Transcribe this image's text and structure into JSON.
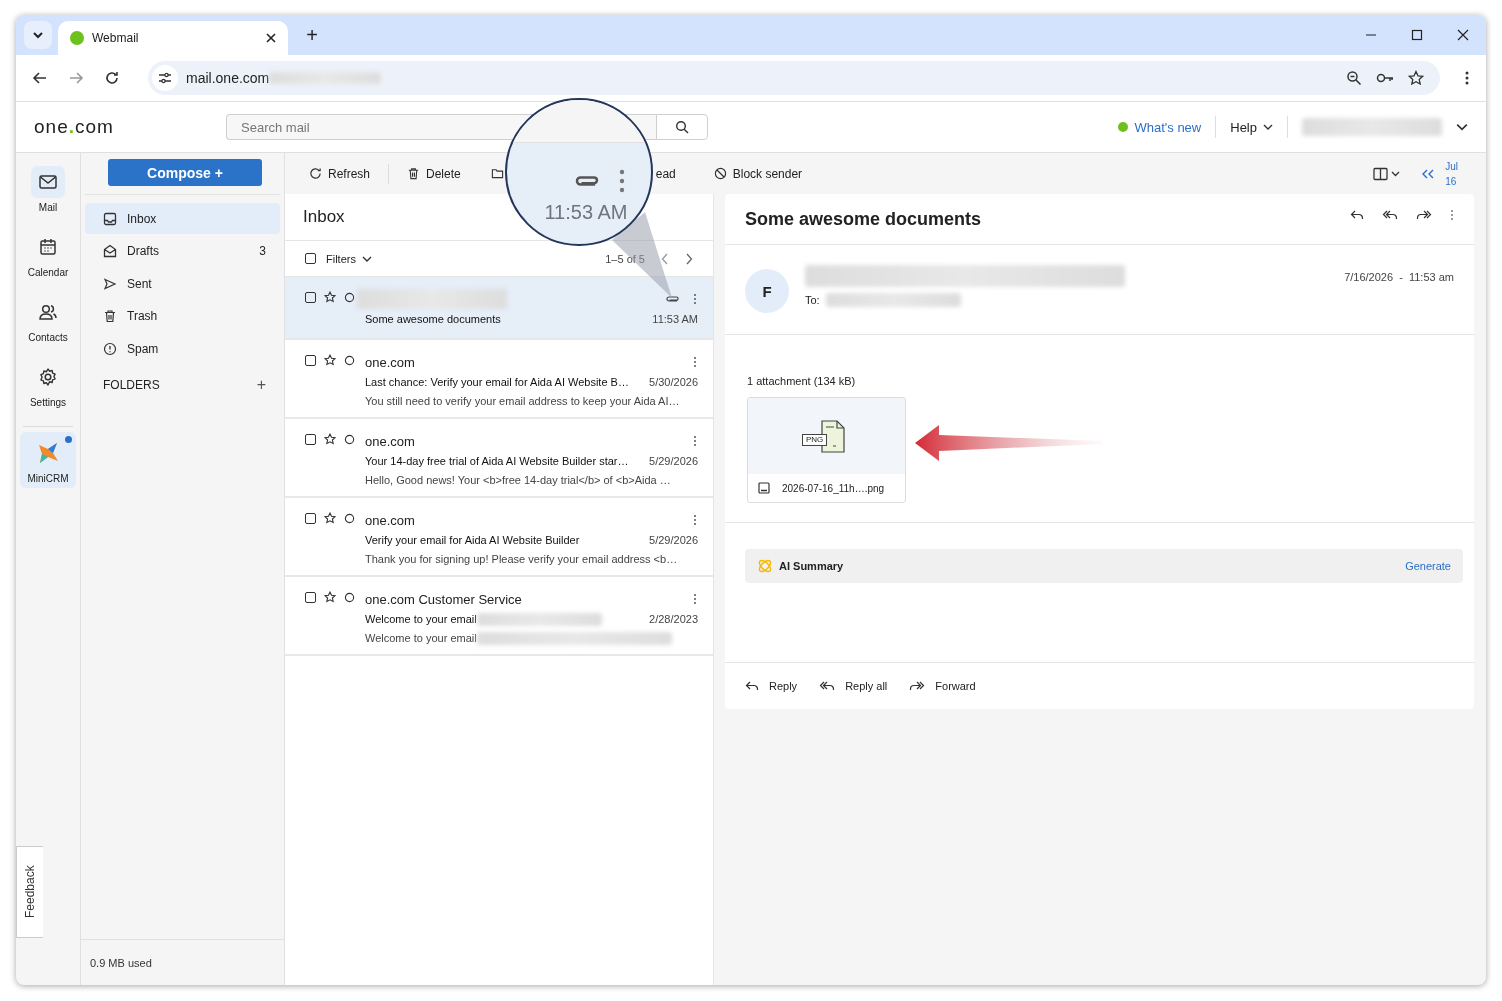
{
  "browser": {
    "tabs": [
      {
        "title": "Webmail",
        "selected": true
      }
    ],
    "new_tab": "+",
    "url": "mail.one.com"
  },
  "header": {
    "logo": [
      "one",
      ".",
      "com"
    ],
    "search": {
      "placeholder": "Search mail"
    },
    "whats_new": "What's new",
    "help": "Help"
  },
  "rail": [
    {
      "label": "Mail",
      "kind": "mail",
      "selected": true
    },
    {
      "label": "Calendar",
      "kind": "calendar",
      "selected": false
    },
    {
      "label": "Contacts",
      "kind": "contacts",
      "selected": false
    },
    {
      "label": "Settings",
      "kind": "settings",
      "selected": false
    },
    {
      "label": "MiniCRM",
      "kind": "crm",
      "selected": true,
      "notification": true
    }
  ],
  "feedback": "Feedback",
  "sidebar": {
    "compose": "Compose +",
    "folders": [
      {
        "name": "Inbox",
        "kind": "inbox",
        "selected": true
      },
      {
        "name": "Drafts",
        "kind": "drafts",
        "count": "3",
        "selected": false
      },
      {
        "name": "Sent",
        "kind": "sent",
        "selected": false
      },
      {
        "name": "Trash",
        "kind": "trash",
        "selected": false
      },
      {
        "name": "Spam",
        "kind": "spam",
        "selected": false
      }
    ],
    "folders_heading": "FOLDERS",
    "add": "+",
    "storage": "0.9 MB used"
  },
  "toolbar": [
    {
      "kind": "refresh",
      "label": "Refresh"
    },
    {
      "kind": "delete",
      "label": "Delete"
    },
    {
      "kind": "move"
    },
    {
      "kind": "text",
      "label": "ead"
    },
    {
      "kind": "block",
      "label": "Block sender"
    }
  ],
  "date_nav": {
    "month": "Jul",
    "day": "16"
  },
  "list": {
    "title": "Inbox",
    "select_all_checked": false,
    "filters": "Filters",
    "range": "1–5 of 5",
    "messages": [
      {
        "subject": "Some awesome documents",
        "date": "11:53 AM",
        "attachment": true,
        "selected": true,
        "checked": false,
        "starred": false
      },
      {
        "sender": "one.com",
        "subject": "Last chance: Verify your email for Aida AI Website B…",
        "preview": "You still need to verify your email address to keep your Aida AI…",
        "date": "5/30/2026",
        "attachment": false,
        "selected": false,
        "checked": false,
        "starred": false
      },
      {
        "sender": "one.com",
        "subject": "Your 14-day free trial of Aida AI Website Builder star…",
        "preview": "Hello, Good news! Your <b>free 14-day trial</b> of <b>Aida …",
        "date": "5/29/2026",
        "attachment": false,
        "selected": false,
        "checked": false,
        "starred": false
      },
      {
        "sender": "one.com",
        "subject": "Verify your email for Aida AI Website Builder",
        "preview": "Thank you for signing up! Please verify your email address <b…",
        "date": "5/29/2026",
        "attachment": false,
        "selected": false,
        "checked": false,
        "starred": false
      },
      {
        "sender": "one.com Customer Service",
        "subject": "Welcome to your email",
        "preview": "Welcome to your email",
        "redacted_tail": true,
        "date": "2/28/2023",
        "attachment": false,
        "selected": false,
        "checked": false,
        "starred": false
      }
    ]
  },
  "magnifier": {
    "time": "11:53 AM"
  },
  "reader": {
    "subject": "Some awesome documents",
    "avatar": "F",
    "to_label": "To:",
    "date": "7/16/2026  -  11:53 am",
    "attachments_heading": "1 attachment (134 kB)",
    "attachment": {
      "badge": "PNG",
      "name": "2026-07-16_11h….png"
    },
    "ai_summary": {
      "label": "AI Summary",
      "action": "Generate"
    },
    "actions": [
      {
        "kind": "reply",
        "label": "Reply"
      },
      {
        "kind": "reply_all",
        "label": "Reply all"
      },
      {
        "kind": "forward",
        "label": "Forward"
      }
    ]
  }
}
